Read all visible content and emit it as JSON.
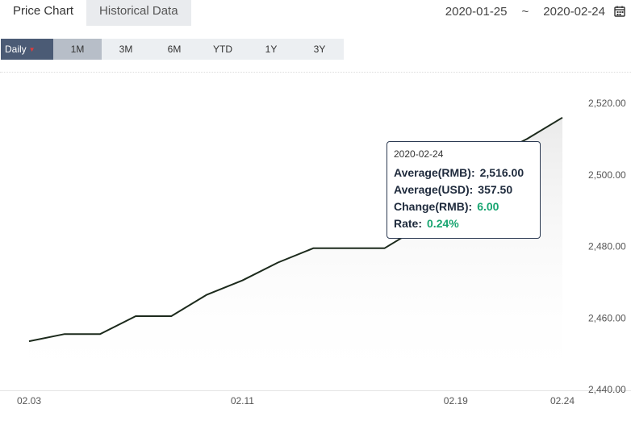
{
  "tabs": [
    {
      "label": "Price Chart"
    },
    {
      "label": "Historical Data"
    }
  ],
  "date_range": {
    "start": "2020-01-25",
    "separator": "~",
    "end": "2020-02-24"
  },
  "periods": [
    {
      "label": "Daily"
    },
    {
      "label": "1M"
    },
    {
      "label": "3M"
    },
    {
      "label": "6M"
    },
    {
      "label": "YTD"
    },
    {
      "label": "1Y"
    },
    {
      "label": "3Y"
    }
  ],
  "tooltip": {
    "date": "2020-02-24",
    "avg_rmb_label": "Average(RMB):",
    "avg_rmb_value": "2,516.00",
    "avg_usd_label": "Average(USD):",
    "avg_usd_value": "357.50",
    "change_label": "Change(RMB):",
    "change_value": "6.00",
    "rate_label": "Rate:",
    "rate_value": "0.24%"
  },
  "colors": {
    "line": "#1c2a1c",
    "accent_green": "#18a571",
    "selected_period": "#4b5b75"
  },
  "chart_data": {
    "type": "line",
    "x": [
      "02.03",
      "02.04",
      "02.05",
      "02.06",
      "02.07",
      "02.10",
      "02.11",
      "02.12",
      "02.13",
      "02.14",
      "02.17",
      "02.18",
      "02.19",
      "02.20",
      "02.21",
      "02.24"
    ],
    "values": [
      2453.5,
      2455.5,
      2455.5,
      2460.5,
      2460.5,
      2466.5,
      2470.5,
      2475.5,
      2479.5,
      2479.5,
      2479.5,
      2485.5,
      2495.0,
      2505.0,
      2510.0,
      2516.0
    ],
    "x_tick_labels": [
      "02.03",
      "02.11",
      "02.19",
      "02.24"
    ],
    "y_tick_labels": [
      "2,520.00",
      "2,500.00",
      "2,480.00",
      "2,460.00",
      "2,440.00"
    ],
    "ylim": [
      2440,
      2520
    ],
    "grid": false
  }
}
